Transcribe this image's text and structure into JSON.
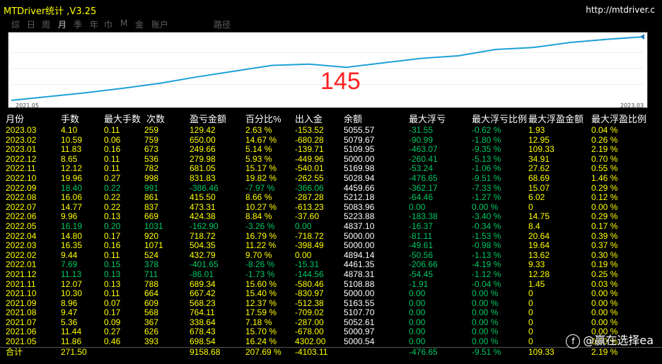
{
  "app": {
    "title": "MTDriver统计 ,V3.25",
    "url": "http://mtdriver.c"
  },
  "tabs": [
    "综",
    "日",
    "周",
    "月",
    "季",
    "年",
    "巾",
    "M",
    "金",
    "账户",
    "路径"
  ],
  "chart": {
    "value": "145",
    "start_label": "2021.05",
    "end_label": "2023.03",
    "curve": [
      0,
      6,
      12,
      19,
      27,
      37,
      46,
      55,
      57,
      52,
      59,
      66,
      70,
      80,
      83,
      91,
      96,
      100
    ]
  },
  "headers": {
    "month": "月份",
    "trades": "手数",
    "maxlots": "最大手数",
    "count": "次数",
    "pnl": "盈亏金额",
    "pct": "百分比%",
    "flow": "出入金",
    "balance": "余额",
    "maxloss": "最大浮亏",
    "maxlossp": "最大浮亏比例",
    "maxprof": "最大浮盈金额",
    "maxprofp": "最大浮盈比例"
  },
  "rows": [
    {
      "m": "2023.03",
      "t": "4.10",
      "l": "0.11",
      "c": "259",
      "p": "129.42",
      "pc": "2.63 %",
      "f": "-153.52",
      "b": "5055.57",
      "ml": "-31.55",
      "mlp": "-0.62 %",
      "mp": "1.93",
      "mpp": "0.04 %",
      "tone": "yellow"
    },
    {
      "m": "2023.02",
      "t": "10.59",
      "l": "0.06",
      "c": "759",
      "p": "650.00",
      "pc": "14.67 %",
      "f": "-680.28",
      "b": "5079.67",
      "ml": "-90.99",
      "mlp": "-1.80 %",
      "mp": "12.95",
      "mpp": "0.26 %",
      "tone": "yellow"
    },
    {
      "m": "2023.01",
      "t": "11.83",
      "l": "0.16",
      "c": "673",
      "p": "249.66",
      "pc": "5.14 %",
      "f": "-139.71",
      "b": "5109.95",
      "ml": "-463.07",
      "mlp": "-9.35 %",
      "mp": "109.33",
      "mpp": "2.19 %",
      "tone": "yellow"
    },
    {
      "m": "2022.12",
      "t": "8.65",
      "l": "0.11",
      "c": "536",
      "p": "279.98",
      "pc": "5.93 %",
      "f": "-449.96",
      "b": "5000.00",
      "ml": "-260.41",
      "mlp": "-5.13 %",
      "mp": "34.91",
      "mpp": "0.70 %",
      "tone": "yellow"
    },
    {
      "m": "2022.11",
      "t": "12.12",
      "l": "0.11",
      "c": "782",
      "p": "681.05",
      "pc": "15.17 %",
      "f": "-540.01",
      "b": "5169.98",
      "ml": "-53.24",
      "mlp": "-1.06 %",
      "mp": "27.62",
      "mpp": "0.55 %",
      "tone": "yellow"
    },
    {
      "m": "2022.10",
      "t": "19.96",
      "l": "0.27",
      "c": "998",
      "p": "831.83",
      "pc": "19.82 %",
      "f": "-262.55",
      "b": "5028.94",
      "ml": "-476.65",
      "mlp": "-9.51 %",
      "mp": "68.69",
      "mpp": "1.46 %",
      "tone": "yellow"
    },
    {
      "m": "2022.09",
      "t": "18.40",
      "l": "0.22",
      "c": "991",
      "p": "-386.46",
      "pc": "-7.97 %",
      "f": "-366.06",
      "b": "4459.66",
      "ml": "-362.17",
      "mlp": "-7.33 %",
      "mp": "15.07",
      "mpp": "0.29 %",
      "tone": "green"
    },
    {
      "m": "2022.08",
      "t": "16.06",
      "l": "0.22",
      "c": "861",
      "p": "415.50",
      "pc": "8.66 %",
      "f": "-287.28",
      "b": "5212.18",
      "ml": "-64.46",
      "mlp": "-1.27 %",
      "mp": "6.02",
      "mpp": "0.12 %",
      "tone": "yellow"
    },
    {
      "m": "2022.07",
      "t": "14.77",
      "l": "0.22",
      "c": "837",
      "p": "473.31",
      "pc": "10.27 %",
      "f": "-613.23",
      "b": "5083.96",
      "ml": "0.00",
      "mlp": "0.00 %",
      "mp": "0",
      "mpp": "0.00 %",
      "tone": "yellow"
    },
    {
      "m": "2022.06",
      "t": "9.96",
      "l": "0.13",
      "c": "669",
      "p": "424.38",
      "pc": "8.84 %",
      "f": "-37.60",
      "b": "5223.88",
      "ml": "-183.38",
      "mlp": "-3.40 %",
      "mp": "14.75",
      "mpp": "0.29 %",
      "tone": "yellow"
    },
    {
      "m": "2022.05",
      "t": "16.19",
      "l": "0.20",
      "c": "1031",
      "p": "-162.90",
      "pc": "-3.26 %",
      "f": "0.00",
      "b": "4837.10",
      "ml": "-16.37",
      "mlp": "-0.34 %",
      "mp": "8.4",
      "mpp": "0.17 %",
      "tone": "green"
    },
    {
      "m": "2022.04",
      "t": "14.80",
      "l": "0.17",
      "c": "920",
      "p": "718.72",
      "pc": "16.79 %",
      "f": "-718.72",
      "b": "5000.00",
      "ml": "-81.11",
      "mlp": "-1.53 %",
      "mp": "20.64",
      "mpp": "0.39 %",
      "tone": "yellow"
    },
    {
      "m": "2022.03",
      "t": "16.35",
      "l": "0.16",
      "c": "1071",
      "p": "504.35",
      "pc": "11.22 %",
      "f": "-398.49",
      "b": "5000.00",
      "ml": "-49.61",
      "mlp": "-0.98 %",
      "mp": "19.64",
      "mpp": "0.37 %",
      "tone": "yellow"
    },
    {
      "m": "2022.02",
      "t": "9.44",
      "l": "0.11",
      "c": "524",
      "p": "432.79",
      "pc": "9.70 %",
      "f": "0.00",
      "b": "4894.14",
      "ml": "-50.56",
      "mlp": "-1.13 %",
      "mp": "13.62",
      "mpp": "0.30 %",
      "tone": "yellow"
    },
    {
      "m": "2022.01",
      "t": "7.69",
      "l": "0.15",
      "c": "378",
      "p": "-401.65",
      "pc": "-8.26 %",
      "f": "-15.31",
      "b": "4461.35",
      "ml": "-206.66",
      "mlp": "-4.19 %",
      "mp": "9.33",
      "mpp": "0.19 %",
      "tone": "green"
    },
    {
      "m": "2021.12",
      "t": "11.13",
      "l": "0.13",
      "c": "711",
      "p": "-86.01",
      "pc": "-1.73 %",
      "f": "-144.56",
      "b": "4878.31",
      "ml": "-54.45",
      "mlp": "-1.12 %",
      "mp": "12.28",
      "mpp": "0.25 %",
      "tone": "green"
    },
    {
      "m": "2021.11",
      "t": "12.07",
      "l": "0.13",
      "c": "788",
      "p": "689.34",
      "pc": "15.60 %",
      "f": "-580.46",
      "b": "5108.88",
      "ml": "-1.91",
      "mlp": "-0.04 %",
      "mp": "1.45",
      "mpp": "0.03 %",
      "tone": "yellow"
    },
    {
      "m": "2021.10",
      "t": "10.30",
      "l": "0.11",
      "c": "664",
      "p": "667.42",
      "pc": "15.40 %",
      "f": "-830.97",
      "b": "5000.00",
      "ml": "0.00",
      "mlp": "0.00 %",
      "mp": "0",
      "mpp": "0.00 %",
      "tone": "yellow"
    },
    {
      "m": "2021.09",
      "t": "8.96",
      "l": "0.07",
      "c": "609",
      "p": "568.23",
      "pc": "12.37 %",
      "f": "-512.38",
      "b": "5163.55",
      "ml": "0.00",
      "mlp": "0.00 %",
      "mp": "0",
      "mpp": "0.00 %",
      "tone": "yellow"
    },
    {
      "m": "2021.08",
      "t": "9.47",
      "l": "0.17",
      "c": "568",
      "p": "764.11",
      "pc": "17.59 %",
      "f": "-709.02",
      "b": "5107.70",
      "ml": "0.00",
      "mlp": "0.00 %",
      "mp": "0",
      "mpp": "0.00 %",
      "tone": "yellow"
    },
    {
      "m": "2021.07",
      "t": "5.36",
      "l": "0.09",
      "c": "367",
      "p": "338.64",
      "pc": "7.18 %",
      "f": "-287.00",
      "b": "5052.61",
      "ml": "0.00",
      "mlp": "0.00 %",
      "mp": "0",
      "mpp": "0.00 %",
      "tone": "yellow"
    },
    {
      "m": "2021.06",
      "t": "11.44",
      "l": "0.27",
      "c": "626",
      "p": "678.43",
      "pc": "15.70 %",
      "f": "-678.00",
      "b": "5000.97",
      "ml": "0.00",
      "mlp": "0.00 %",
      "mp": "0",
      "mpp": "0.00 %",
      "tone": "yellow"
    },
    {
      "m": "2021.05",
      "t": "11.86",
      "l": "0.46",
      "c": "393",
      "p": "698.54",
      "pc": "16.24 %",
      "f": "4302.00",
      "b": "5000.54",
      "ml": "0.00",
      "mlp": "0.00 %",
      "mp": "0",
      "mpp": "0.00 %",
      "tone": "yellow"
    }
  ],
  "totals": {
    "m": "合计",
    "t": "271.50",
    "p": "9158.68",
    "pc": "207.69 %",
    "f": "-4103.11",
    "ml": "-476.65",
    "mlp": "-9.51 %",
    "mp": "109.33",
    "mpp": "2.19 %"
  },
  "watermark": {
    "logo": "f",
    "text": "@赢在选择ea"
  }
}
